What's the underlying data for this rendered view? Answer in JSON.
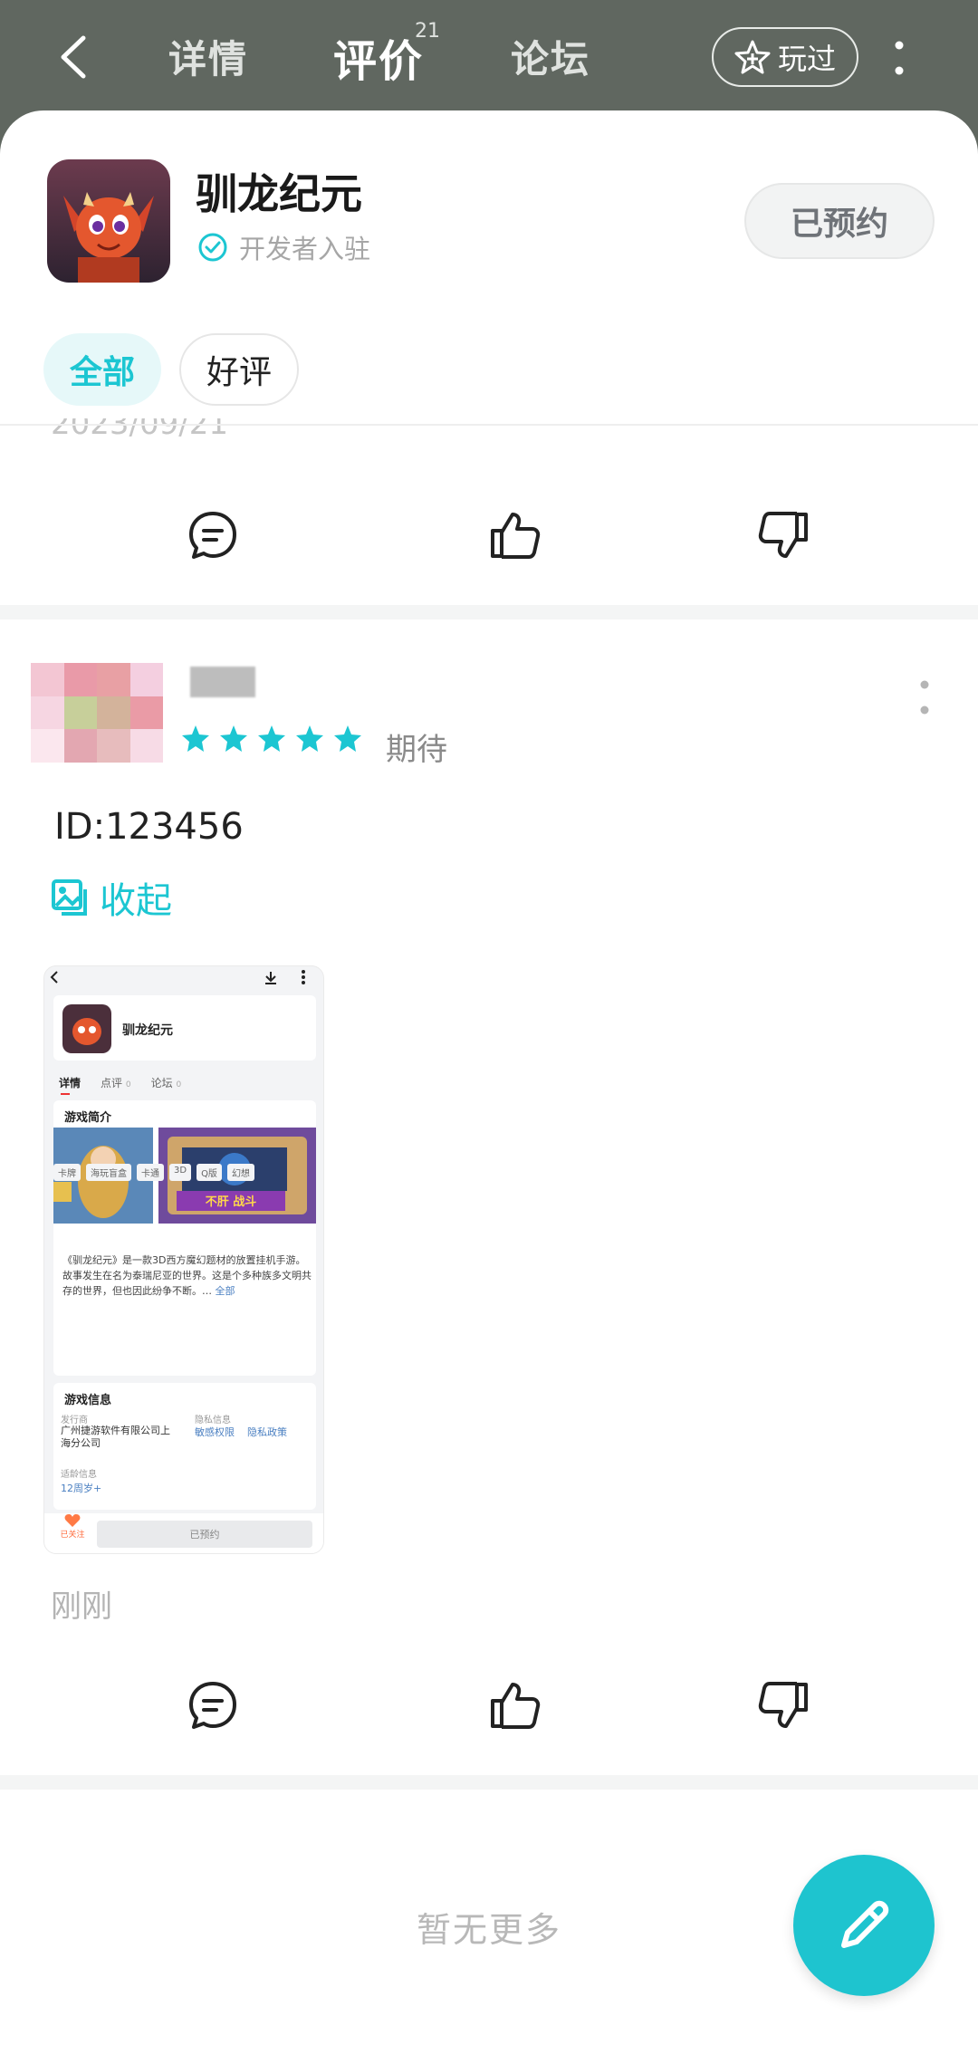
{
  "header": {
    "tabs": [
      {
        "label": "详情"
      },
      {
        "label": "评价",
        "badge": "21"
      },
      {
        "label": "论坛"
      }
    ],
    "played_label": "玩过"
  },
  "app": {
    "name": "驯龙纪元",
    "verified_label": "开发者入驻",
    "reserve_label": "已预约",
    "accent": "#1cc6d2"
  },
  "filters": [
    {
      "label": "全部",
      "active": true
    },
    {
      "label": "好评",
      "active": false
    }
  ],
  "previous_review": {
    "date": "2023/09/21"
  },
  "review": {
    "stars": 5,
    "rating_label": "期待",
    "text": "ID:123456",
    "collapse_label": "收起",
    "time": "刚刚",
    "screenshot": {
      "app_name": "驯龙纪元",
      "tabs": [
        "详情",
        "点评",
        "论坛"
      ],
      "tab_counts": [
        "",
        "0",
        "0"
      ],
      "intro_title": "游戏简介",
      "banner_text": "不肝 战斗",
      "tags": [
        "卡牌",
        "海玩盲盒",
        "卡通",
        "3D",
        "Q版",
        "幻想"
      ],
      "description": "《驯龙纪元》是一款3D西方魔幻题材的放置挂机手游。故事发生在名为泰瑞尼亚的世界。这是个多种族多文明共存的世界，但也因此纷争不断。…",
      "description_more": "全部",
      "info_title": "游戏信息",
      "publisher_label": "发行商",
      "publisher": "广州捷游软件有限公司上海分公司",
      "privacy_label": "隐私信息",
      "privacy_links": [
        "敏感权限",
        "隐私政策"
      ],
      "age_label": "适龄信息",
      "age": "12周岁+",
      "follow_label": "已关注",
      "reserved_label": "已预约"
    }
  },
  "footer": {
    "no_more": "暂无更多"
  }
}
